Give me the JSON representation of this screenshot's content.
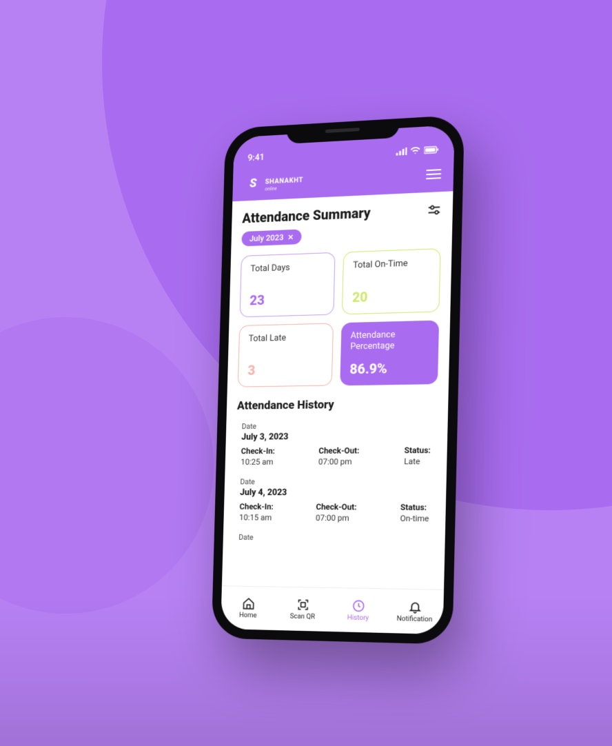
{
  "status_bar": {
    "time": "9:41"
  },
  "brand": {
    "name": "SHANAKHT",
    "tagline": "online"
  },
  "summary": {
    "title": "Attendance Summary",
    "filter_label": "July 2023",
    "cards": {
      "total_days": {
        "label": "Total Days",
        "value": "23"
      },
      "total_ontime": {
        "label": "Total On-Time",
        "value": "20"
      },
      "total_late": {
        "label": "Total Late",
        "value": "3"
      },
      "percentage": {
        "label": "Attendance Percentage",
        "value": "86.9%"
      }
    }
  },
  "history": {
    "title": "Attendance History",
    "labels": {
      "date": "Date",
      "checkin": "Check-In:",
      "checkout": "Check-Out:",
      "status": "Status:"
    },
    "entries": [
      {
        "date": "July 3, 2023",
        "checkin": "10:25 am",
        "checkout": "07:00 pm",
        "status": "Late",
        "status_kind": "late"
      },
      {
        "date": "July 4, 2023",
        "checkin": "10:15 am",
        "checkout": "07:00 pm",
        "status": "On-time",
        "status_kind": "ontime"
      }
    ]
  },
  "nav": {
    "home": "Home",
    "scan_qr": "Scan QR",
    "history": "History",
    "notification": "Notification"
  }
}
